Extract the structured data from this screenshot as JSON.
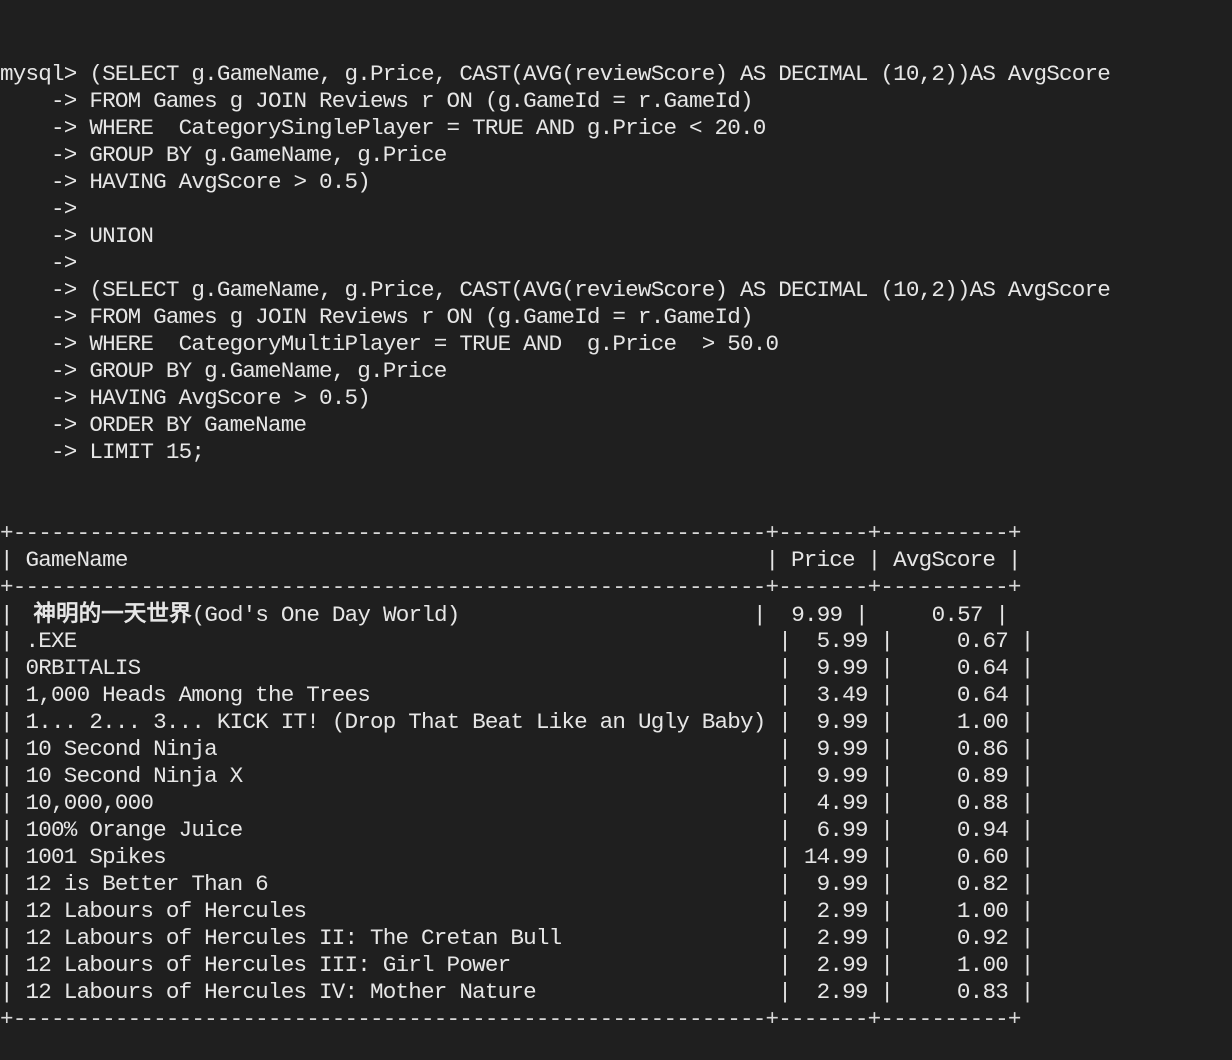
{
  "prompt": "mysql>",
  "continuation": "    ->",
  "query_lines": [
    " (SELECT g.GameName, g.Price, CAST(AVG(reviewScore) AS DECIMAL (10,2))AS AvgScore",
    " FROM Games g JOIN Reviews r ON (g.GameId = r.GameId)",
    " WHERE  CategorySinglePlayer = TRUE AND g.Price < 20.0",
    " GROUP BY g.GameName, g.Price",
    " HAVING AvgScore > 0.5)",
    "",
    " UNION",
    "",
    " (SELECT g.GameName, g.Price, CAST(AVG(reviewScore) AS DECIMAL (10,2))AS AvgScore",
    " FROM Games g JOIN Reviews r ON (g.GameId = r.GameId)",
    " WHERE  CategoryMultiPlayer = TRUE AND  g.Price  > 50.0",
    " GROUP BY g.GameName, g.Price",
    " HAVING AvgScore > 0.5)",
    " ORDER BY GameName",
    " LIMIT 15;"
  ],
  "table": {
    "border": "+-----------------------------------------------------------+-------+----------+",
    "header": "| GameName                                                  | Price | AvgScore |",
    "header_cols": [
      "GameName",
      "Price",
      "AvgScore"
    ],
    "rows": [
      {
        "name": "神明的一天世界",
        "name_suffix": "(God's One Day World)",
        "price": "9.99",
        "score": "0.57"
      },
      {
        "name": ".EXE",
        "name_suffix": "",
        "price": "5.99",
        "score": "0.67"
      },
      {
        "name": "0RBITALIS",
        "name_suffix": "",
        "price": "9.99",
        "score": "0.64"
      },
      {
        "name": "1,000 Heads Among the Trees",
        "name_suffix": "",
        "price": "3.49",
        "score": "0.64"
      },
      {
        "name": "1... 2... 3... KICK IT! (Drop That Beat Like an Ugly Baby)",
        "name_suffix": "",
        "price": "9.99",
        "score": "1.00"
      },
      {
        "name": "10 Second Ninja",
        "name_suffix": "",
        "price": "9.99",
        "score": "0.86"
      },
      {
        "name": "10 Second Ninja X",
        "name_suffix": "",
        "price": "9.99",
        "score": "0.89"
      },
      {
        "name": "10,000,000",
        "name_suffix": "",
        "price": "4.99",
        "score": "0.88"
      },
      {
        "name": "100% Orange Juice",
        "name_suffix": "",
        "price": "6.99",
        "score": "0.94"
      },
      {
        "name": "1001 Spikes",
        "name_suffix": "",
        "price": "14.99",
        "score": "0.60"
      },
      {
        "name": "12 is Better Than 6",
        "name_suffix": "",
        "price": "9.99",
        "score": "0.82"
      },
      {
        "name": "12 Labours of Hercules",
        "name_suffix": "",
        "price": "2.99",
        "score": "1.00"
      },
      {
        "name": "12 Labours of Hercules II: The Cretan Bull",
        "name_suffix": "",
        "price": "2.99",
        "score": "0.92"
      },
      {
        "name": "12 Labours of Hercules III: Girl Power",
        "name_suffix": "",
        "price": "2.99",
        "score": "1.00"
      },
      {
        "name": "12 Labours of Hercules IV: Mother Nature",
        "name_suffix": "",
        "price": "2.99",
        "score": "0.83"
      }
    ]
  },
  "colors": {
    "background": "#1f1f1f",
    "text": "#e6e6e6"
  }
}
